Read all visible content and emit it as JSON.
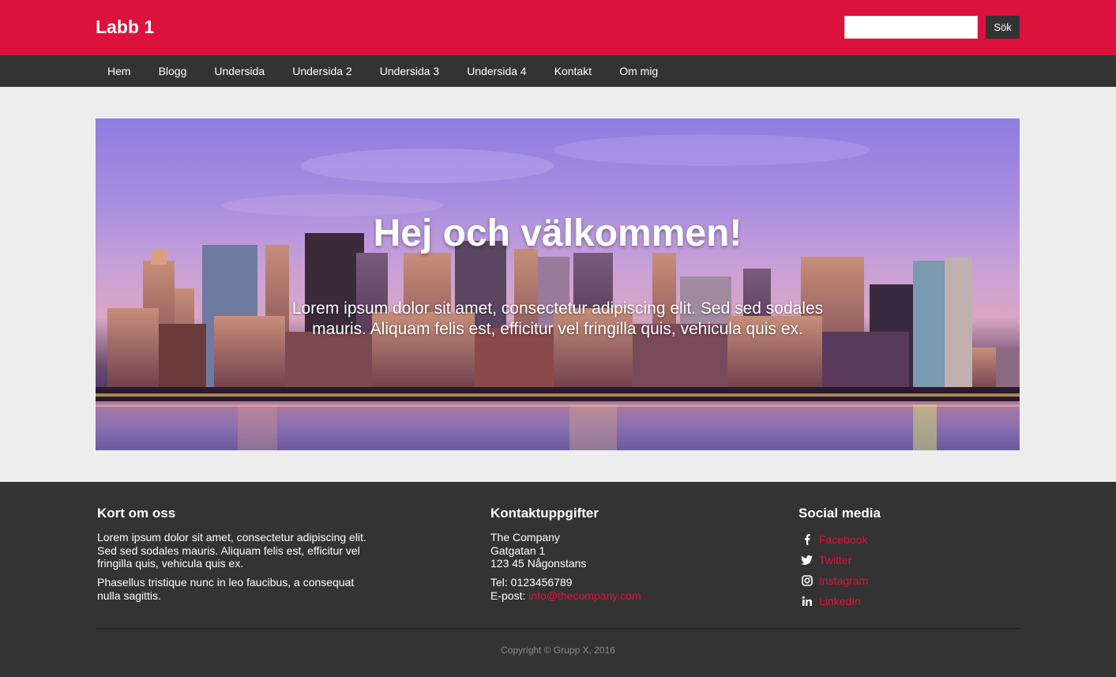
{
  "header": {
    "logo": "Labb 1",
    "search": {
      "placeholder": "",
      "value": "",
      "button_label": "Sök"
    }
  },
  "nav": {
    "items": [
      {
        "label": "Hem"
      },
      {
        "label": "Blogg"
      },
      {
        "label": "Undersida"
      },
      {
        "label": "Undersida 2"
      },
      {
        "label": "Undersida 3"
      },
      {
        "label": "Undersida 4"
      },
      {
        "label": "Kontakt"
      },
      {
        "label": "Om mig"
      }
    ]
  },
  "hero": {
    "title": "Hej och välkommen!",
    "text": "Lorem ipsum dolor sit amet, consectetur adipiscing elit. Sed sed sodales mauris. Aliquam felis est, efficitur vel fringilla quis, vehicula quis ex."
  },
  "footer": {
    "about": {
      "title": "Kort om oss",
      "paragraph1": "Lorem ipsum dolor sit amet, consectetur adipiscing elit. Sed sed sodales mauris. Aliquam felis est, efficitur vel fringilla quis, vehicula quis ex.",
      "paragraph2": "Phasellus tristique nunc in leo faucibus, a consequat nulla sagittis."
    },
    "contact": {
      "title": "Kontaktuppgifter",
      "company": "The Company",
      "street": "Gatgatan 1",
      "city": "123 45 Någonstans",
      "phone": "Tel: 0123456789",
      "email_label": "E-post:",
      "email": "info@thecompany.com"
    },
    "social": {
      "title": "Social media",
      "items": [
        {
          "label": "Facebook",
          "icon": "facebook-icon"
        },
        {
          "label": "Twitter",
          "icon": "twitter-icon"
        },
        {
          "label": "Instagram",
          "icon": "instagram-icon"
        },
        {
          "label": "LinkedIn",
          "icon": "linkedin-icon"
        }
      ]
    },
    "copyright": "Copyright © Grupp X, 2016"
  },
  "colors": {
    "brand": "#dc123c",
    "dark": "#333333",
    "background": "#ededed"
  }
}
